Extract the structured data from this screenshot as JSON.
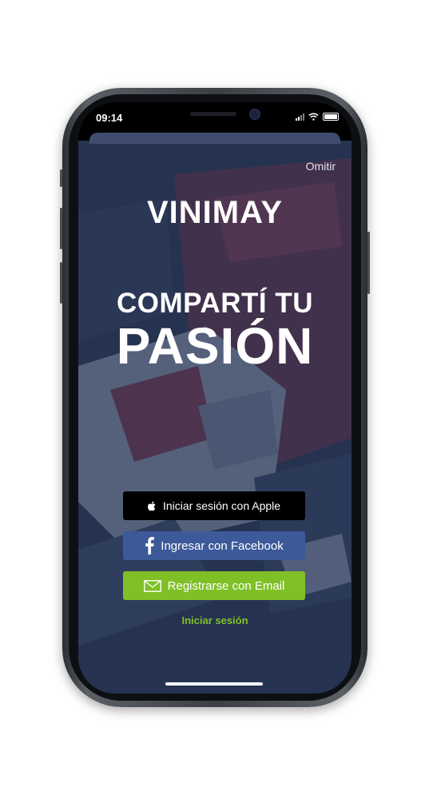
{
  "status_bar": {
    "time": "09:14"
  },
  "top_action": {
    "skip_label": "Omitir"
  },
  "brand": {
    "logo_text": "VINIMAY"
  },
  "hero": {
    "line1": "COMPARTÍ TU",
    "line2": "PASIÓN"
  },
  "auth": {
    "apple_label": "Iniciar sesión con Apple",
    "facebook_label": "Ingresar con Facebook",
    "email_label": "Registrarse con Email",
    "login_label": "Iniciar sesión"
  },
  "colors": {
    "overlay": "#263456",
    "apple_button": "#000000",
    "facebook_button": "#3c5a9a",
    "email_button": "#7fc026",
    "link_accent": "#7fc026"
  },
  "icons": [
    "apple-icon",
    "facebook-icon",
    "envelope-icon",
    "wifi-icon",
    "battery-icon",
    "signal-icon"
  ]
}
